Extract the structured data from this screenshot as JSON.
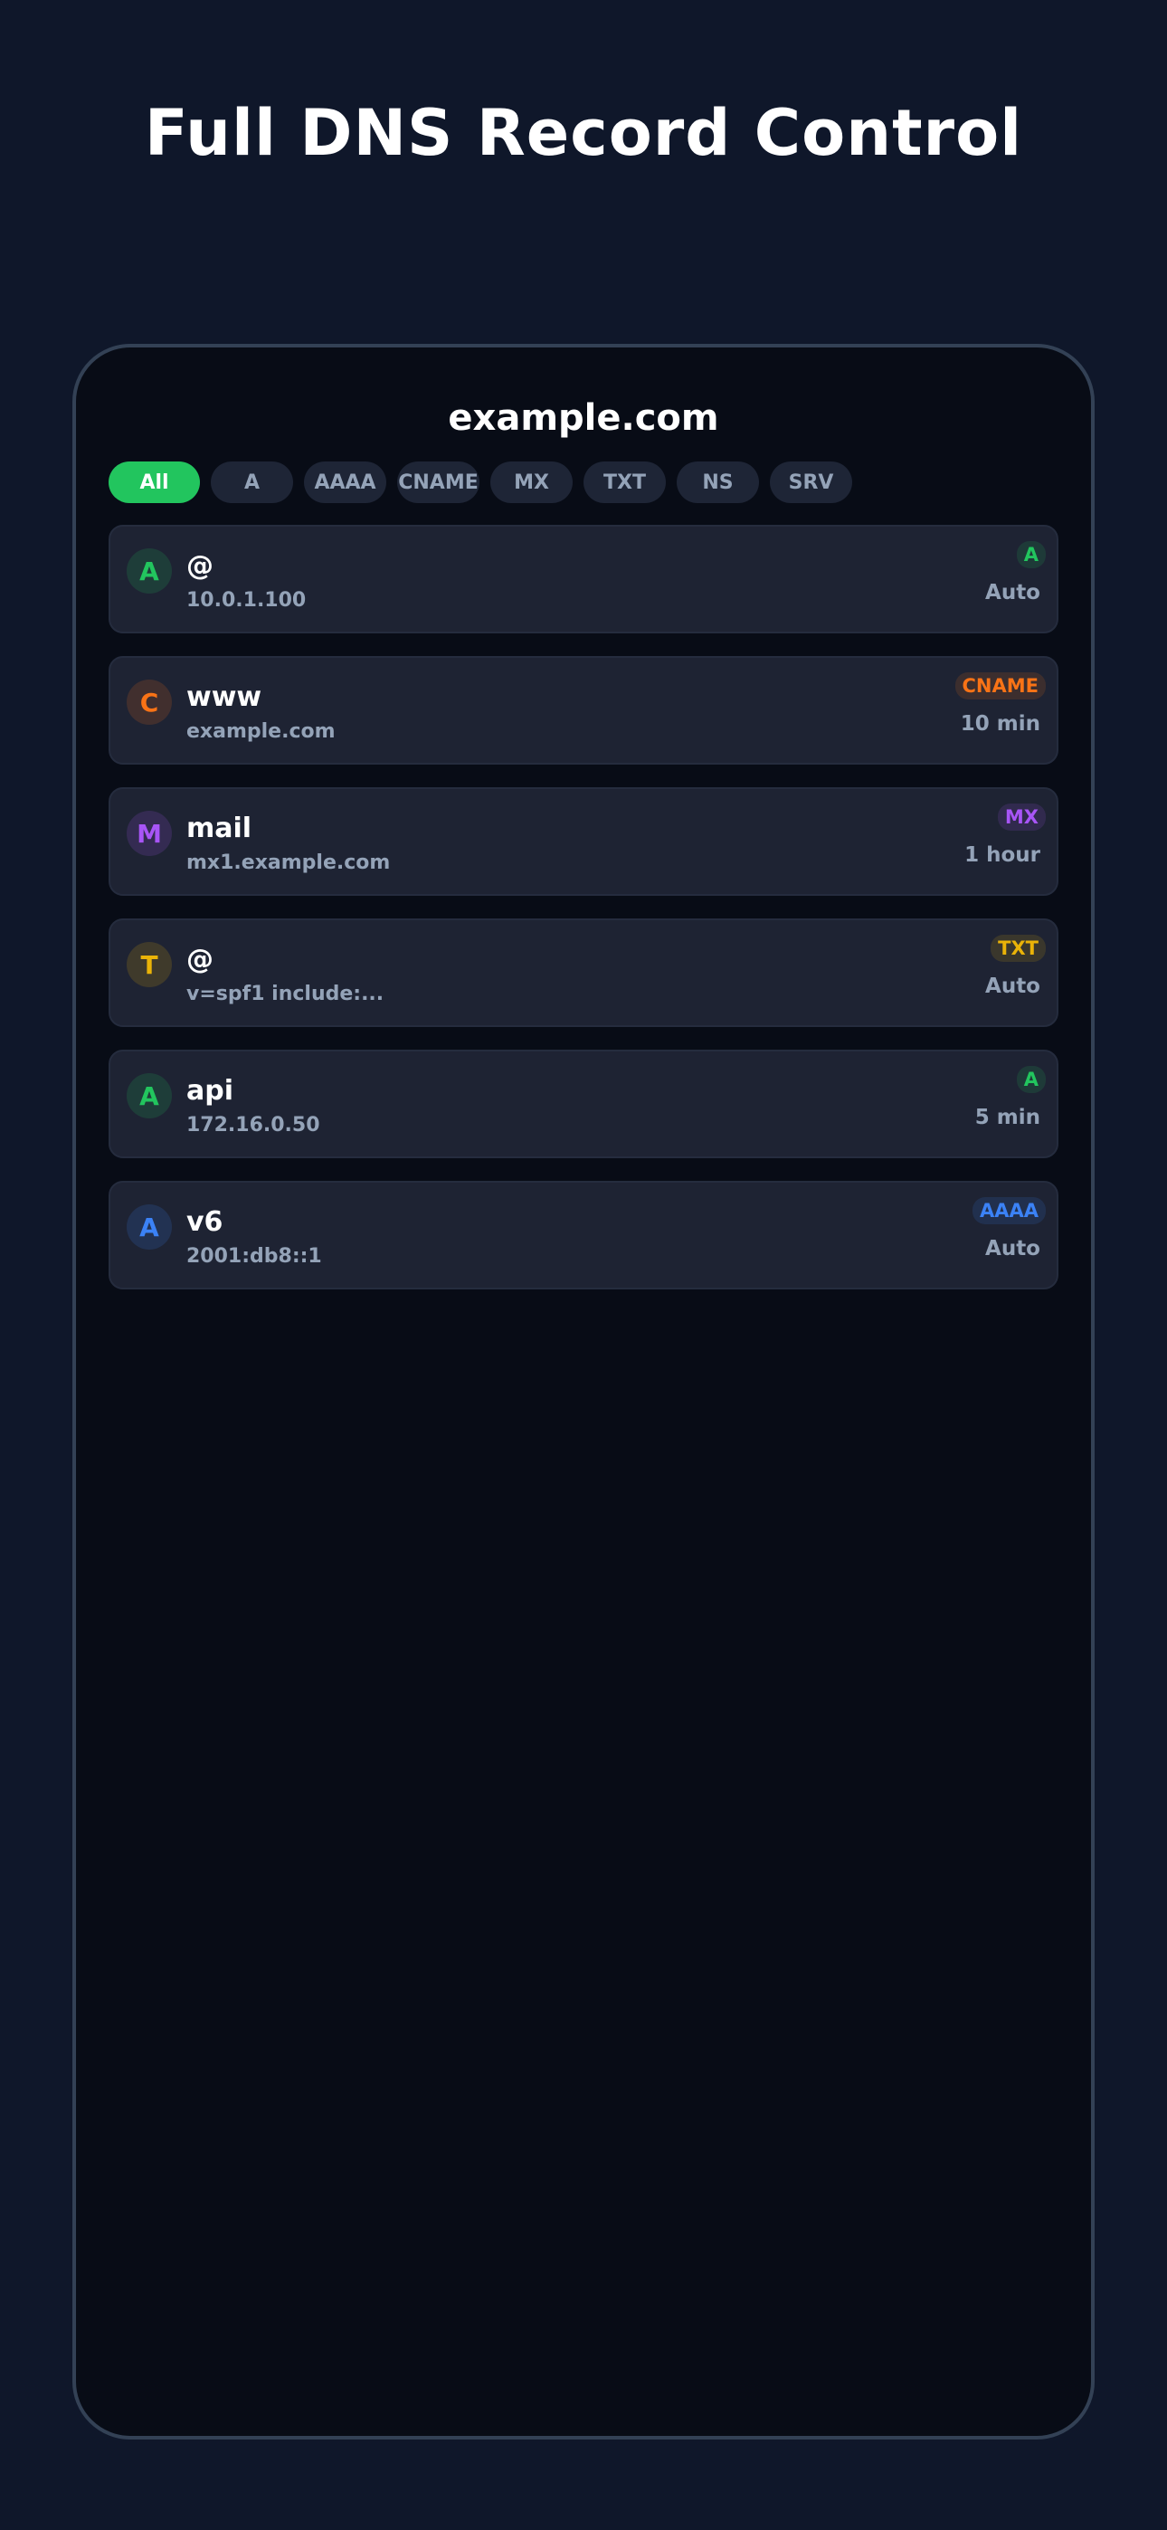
{
  "headline": "Full DNS Record Control",
  "domain": "example.com",
  "filters": [
    "All",
    "A",
    "AAAA",
    "CNAME",
    "MX",
    "TXT",
    "NS",
    "SRV"
  ],
  "active_filter": "All",
  "colors": {
    "A": "#22c55e",
    "CNAME": "#f97316",
    "MX": "#a855f7",
    "TXT": "#eab308",
    "AAAA": "#3b82f6",
    "active_chip": "#22c55e"
  },
  "records": [
    {
      "icon_letter": "A",
      "name": "@",
      "value": "10.0.1.100",
      "type": "A",
      "ttl": "Auto"
    },
    {
      "icon_letter": "C",
      "name": "www",
      "value": "example.com",
      "type": "CNAME",
      "ttl": "10 min"
    },
    {
      "icon_letter": "M",
      "name": "mail",
      "value": "mx1.example.com",
      "type": "MX",
      "ttl": "1 hour"
    },
    {
      "icon_letter": "T",
      "name": "@",
      "value": "v=spf1 include:...",
      "type": "TXT",
      "ttl": "Auto"
    },
    {
      "icon_letter": "A",
      "name": "api",
      "value": "172.16.0.50",
      "type": "A",
      "ttl": "5 min"
    },
    {
      "icon_letter": "A",
      "name": "v6",
      "value": "2001:db8::1",
      "type": "AAAA",
      "ttl": "Auto"
    }
  ]
}
